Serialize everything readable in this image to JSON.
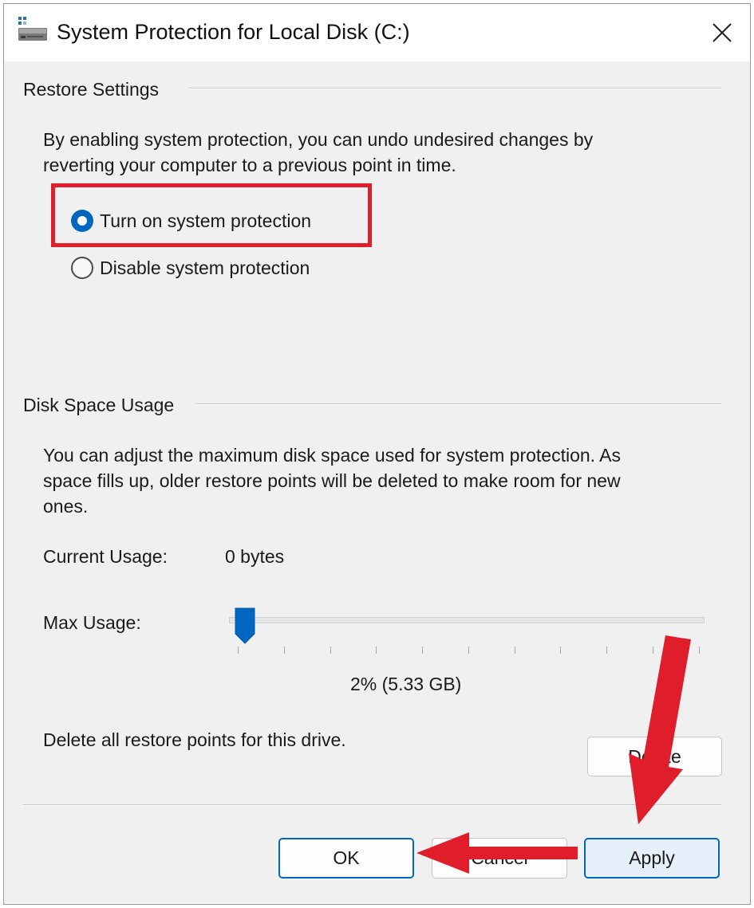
{
  "window": {
    "title": "System Protection for Local Disk (C:)",
    "app_icon": "disk-drive-icon",
    "close_icon": "close-icon"
  },
  "restore_settings": {
    "group_title": "Restore Settings",
    "description_line1": "By enabling system protection, you can undo undesired changes by",
    "description_line2": "reverting your computer to a previous point in time.",
    "options": [
      {
        "label": "Turn on system protection",
        "selected": true
      },
      {
        "label": "Disable system protection",
        "selected": false
      }
    ]
  },
  "disk_space_usage": {
    "group_title": "Disk Space Usage",
    "description_line1": "You can adjust the maximum disk space used for system protection. As",
    "description_line2": "space fills up, older restore points will be deleted to make room for new",
    "description_line3": "ones.",
    "current_usage_label": "Current Usage:",
    "current_usage_value": "0 bytes",
    "max_usage_label": "Max Usage:",
    "max_usage_value": "2% (5.33 GB)",
    "max_usage_percent": 2,
    "delete_text": "Delete all restore points for this drive.",
    "delete_button": "Delete"
  },
  "buttons": {
    "ok": "OK",
    "cancel": "Cancel",
    "apply": "Apply"
  },
  "annotations": {
    "highlight_color": "#e01e2b",
    "arrow_color": "#e01e2b"
  },
  "colors": {
    "accent": "#0067c0",
    "dialog_bg": "#f0f0f0"
  }
}
